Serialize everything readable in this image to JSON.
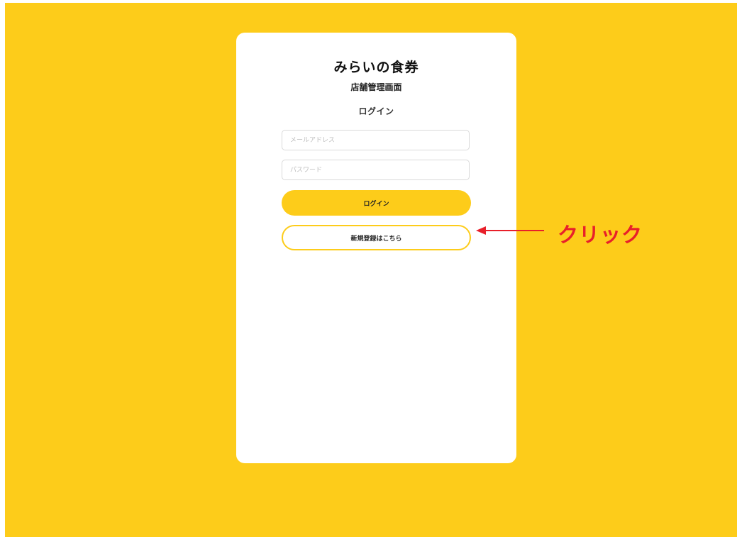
{
  "colors": {
    "background": "#FDCC1A",
    "card": "#FFFFFF",
    "accent": "#FDCC1A",
    "annotation": "#E8202A"
  },
  "brand": {
    "title": "みらいの食券",
    "subtitle": "店舗管理画面"
  },
  "login_form": {
    "heading": "ログイン",
    "email": {
      "value": "",
      "placeholder": "メールアドレス"
    },
    "password": {
      "value": "",
      "placeholder": "パスワード"
    },
    "login_button_label": "ログイン",
    "register_button_label": "新規登録はこちら"
  },
  "annotation": {
    "icon": "left-arrow-icon",
    "text": "クリック"
  }
}
